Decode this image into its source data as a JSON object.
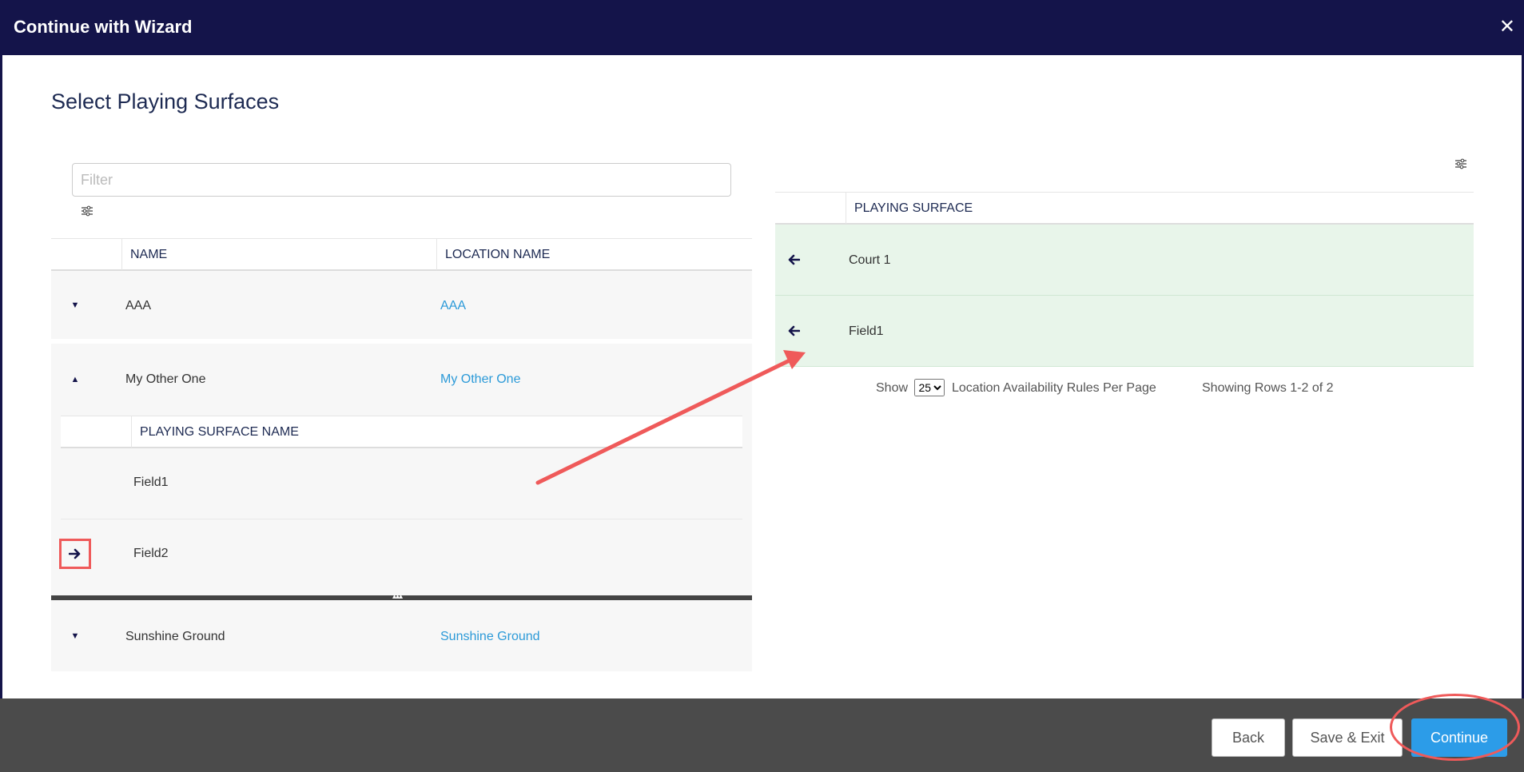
{
  "dialog": {
    "title": "Continue with Wizard",
    "close_glyph": "✕"
  },
  "page_title": "Select Playing Surfaces",
  "filter": {
    "placeholder": "Filter",
    "value": ""
  },
  "left_table": {
    "columns": [
      "NAME",
      "LOCATION NAME"
    ],
    "rows": [
      {
        "name": "AAA",
        "location": "AAA",
        "expanded": false
      },
      {
        "name": "My Other One",
        "location": "My Other One",
        "expanded": true
      },
      {
        "name": "Sunshine Ground",
        "location": "Sunshine Ground",
        "expanded": false
      }
    ],
    "subtable": {
      "column": "PLAYING SURFACE NAME",
      "rows": [
        {
          "name": "Field1"
        },
        {
          "name": "Field2"
        }
      ]
    }
  },
  "right_table": {
    "column": "PLAYING SURFACE",
    "rows": [
      {
        "name": "Court 1"
      },
      {
        "name": "Field1"
      }
    ],
    "pager": {
      "show_label": "Show",
      "page_size": "25",
      "suffix_label": "Location Availability Rules Per Page",
      "showing_text": "Showing Rows 1-2 of 2"
    }
  },
  "footer": {
    "back_label": "Back",
    "save_exit_label": "Save & Exit",
    "continue_label": "Continue"
  },
  "colors": {
    "header_bg": "#14144a",
    "accent": "#2c9ce8",
    "link": "#2c9ad8",
    "annotation": "#ef5a5a",
    "selected_row": "#e8f5ea",
    "footer_bg": "#4b4b4b"
  }
}
